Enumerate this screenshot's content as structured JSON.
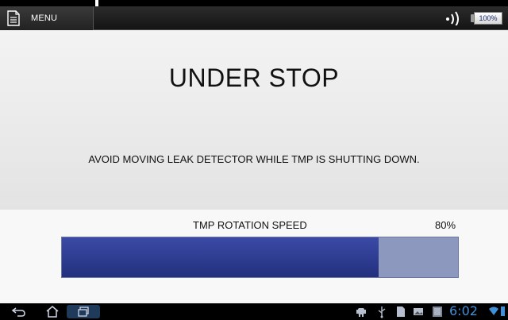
{
  "action_bar": {
    "menu_label": "MENU",
    "menu_icon": "document-icon",
    "signal_icon": "signal-icon",
    "battery_level": "100%"
  },
  "status": {
    "title": "UNDER STOP",
    "message": "AVOID MOVING LEAK DETECTOR WHILE TMP IS SHUTTING DOWN."
  },
  "tmp_speed": {
    "label": "TMP ROTATION SPEED",
    "value_text": "80%",
    "fraction": 0.8,
    "fill_color": "#2c3a92",
    "track_color": "#8c98be"
  },
  "nav_bar": {
    "buttons": [
      "back-icon",
      "home-icon",
      "recent-apps-icon"
    ],
    "clock": "6:02",
    "accent_color": "#3f8fd9"
  }
}
